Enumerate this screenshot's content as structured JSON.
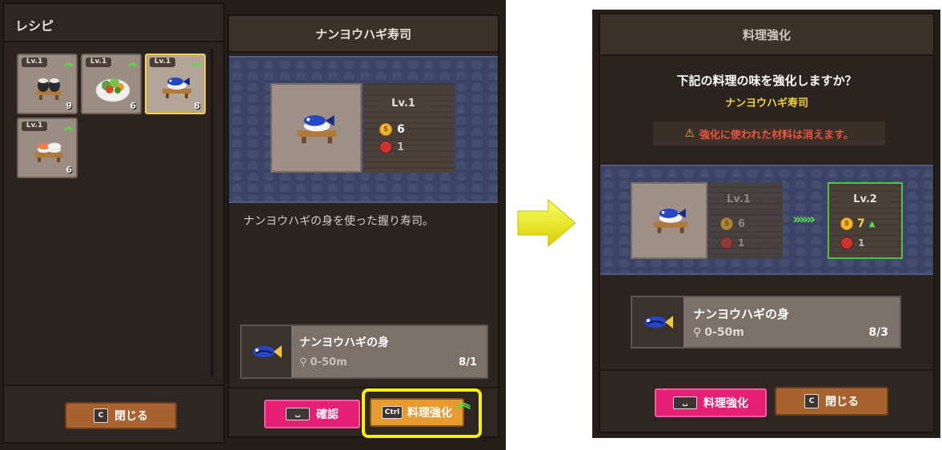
{
  "left_panel": {
    "title": "レシピ",
    "close_key": "C",
    "close_label": "閉じる",
    "recipes": [
      {
        "level": "Lv.1",
        "count": "9",
        "upgradable": true,
        "icon": "seaweed-sushi-icon"
      },
      {
        "level": "Lv.1",
        "count": "6",
        "upgradable": true,
        "icon": "salad-bowl-icon"
      },
      {
        "level": "Lv.1",
        "count": "8",
        "upgradable": true,
        "icon": "blue-tang-sushi-icon",
        "selected": true
      },
      {
        "level": "Lv.1",
        "count": "6",
        "upgradable": true,
        "icon": "salmon-sushi-icon"
      }
    ]
  },
  "detail_panel": {
    "title": "ナンヨウハギ寿司",
    "level": "Lv.1",
    "price": "6",
    "stock": "1",
    "description": "ナンヨウハギの身を使った握り寿司。",
    "material": {
      "name": "ナンヨウハギの身",
      "location": "0-50m",
      "quantity": "8/1"
    },
    "confirm_key": "␣",
    "confirm_label": "確認",
    "upgrade_key": "Ctrl",
    "upgrade_label": "料理強化"
  },
  "dialog": {
    "title": "料理強化",
    "question": "下記の料理の味を強化しますか？",
    "dish_name": "ナンヨウハギ寿司",
    "warning": "強化に使われた材料は消えます。",
    "from": {
      "level": "Lv.1",
      "price": "6",
      "stock": "1"
    },
    "arrow": "»»»",
    "to": {
      "level": "Lv.2",
      "price": "7",
      "price_change": "▲",
      "stock": "1"
    },
    "material": {
      "name": "ナンヨウハギの身",
      "location": "0-50m",
      "quantity": "8/3"
    },
    "confirm_key": "␣",
    "confirm_label": "料理強化",
    "close_key": "C",
    "close_label": "閉じる"
  },
  "colors": {
    "accent_pink": "#e51e76",
    "upgrade_green": "#55e04a",
    "highlight_yellow": "#f8f000",
    "warning_red": "#e8553a",
    "dish_name_yellow": "#f2d23a"
  }
}
